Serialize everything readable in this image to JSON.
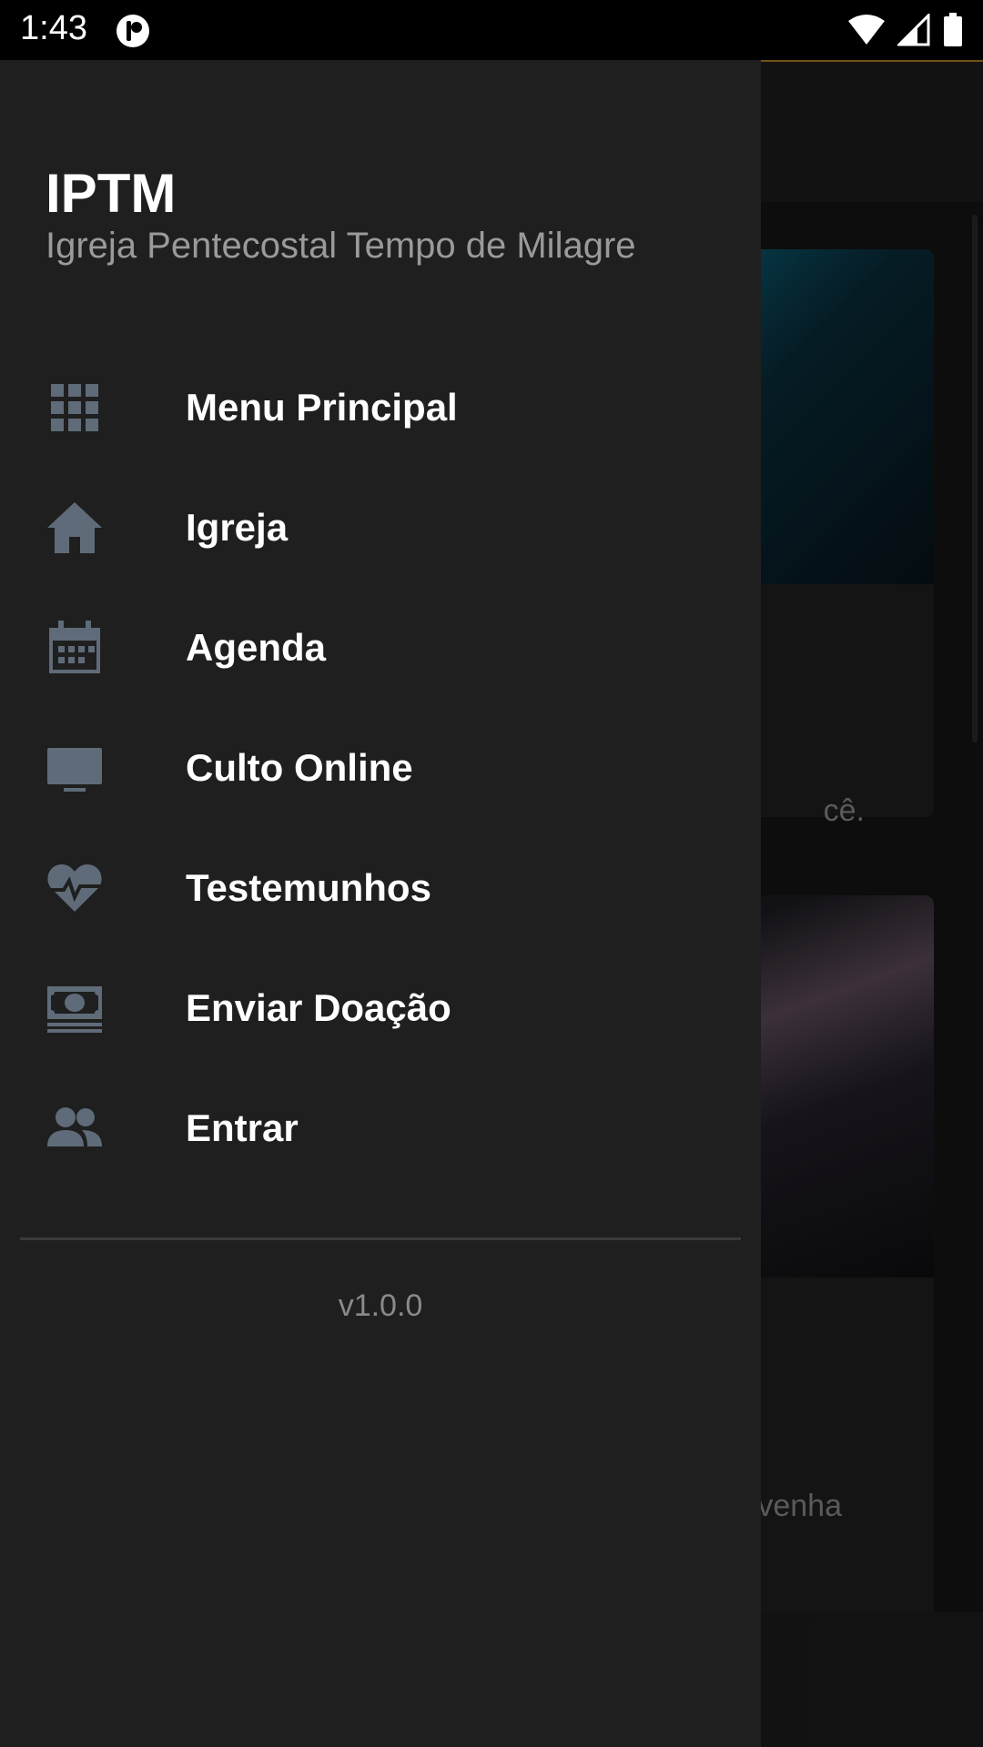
{
  "status_bar": {
    "time": "1:43"
  },
  "drawer": {
    "title": "IPTM",
    "subtitle": "Igreja Pentecostal Tempo de Milagre",
    "items": [
      {
        "label": "Menu Principal",
        "icon": "grid-icon"
      },
      {
        "label": "Igreja",
        "icon": "home-icon"
      },
      {
        "label": "Agenda",
        "icon": "calendar-icon"
      },
      {
        "label": "Culto Online",
        "icon": "tv-icon"
      },
      {
        "label": "Testemunhos",
        "icon": "heartbeat-icon"
      },
      {
        "label": "Enviar Doação",
        "icon": "money-icon"
      },
      {
        "label": "Entrar",
        "icon": "users-icon"
      }
    ],
    "version": "v1.0.0"
  },
  "background": {
    "card1_snippet": "cê.",
    "card2_snippet": "venha"
  },
  "colors": {
    "drawer_bg": "#1f1f1f",
    "icon_color": "#5f6b78",
    "accent_line": "#b07a25"
  }
}
